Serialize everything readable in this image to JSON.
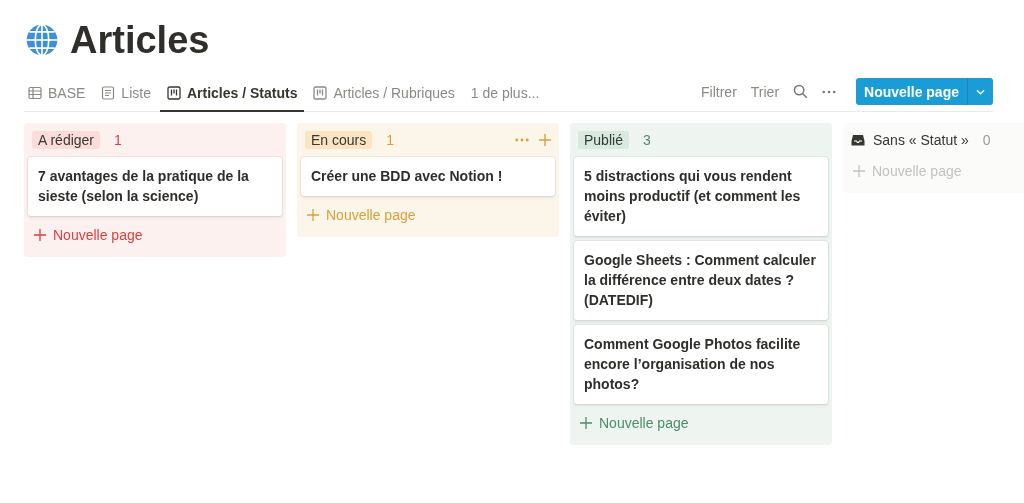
{
  "page": {
    "title": "Articles"
  },
  "tabs": [
    {
      "label": "BASE",
      "kind": "table",
      "selected": false
    },
    {
      "label": "Liste",
      "kind": "list",
      "selected": false
    },
    {
      "label": "Articles / Statuts",
      "kind": "board",
      "selected": true
    },
    {
      "label": "Articles / Rubriques",
      "kind": "board",
      "selected": false
    },
    {
      "label": "1 de plus...",
      "kind": "more",
      "selected": false
    }
  ],
  "toolbar": {
    "filter": "Filtrer",
    "sort": "Trier",
    "new_button": "Nouvelle page"
  },
  "columns": [
    {
      "kind": "status",
      "name": "A rédiger",
      "count": "1",
      "color": "#e03e3e",
      "hovered": false,
      "cards": [
        "7 avantages de la pratique de la sieste (selon la science)"
      ],
      "add_label": "Nouvelle page"
    },
    {
      "kind": "status",
      "name": "En cours",
      "count": "1",
      "color": "#d9a03a",
      "hovered": true,
      "cards": [
        "Créer une BDD avec Notion !"
      ],
      "add_label": "Nouvelle page"
    },
    {
      "kind": "status",
      "name": "Publié",
      "count": "3",
      "color": "#4d8b6a",
      "hovered": false,
      "cards": [
        "5 distractions qui vous rendent moins productif (et comment les éviter)",
        "Google Sheets : Comment calculer la différence entre deux dates ? (DATEDIF)",
        "Comment Google Photos facilite encore l’organisation de nos photos?"
      ],
      "add_label": "Nouvelle page"
    },
    {
      "kind": "none",
      "name": "Sans « Statut »",
      "count": "0",
      "color": "#9b9a97",
      "add_label": "Nouvelle page"
    }
  ]
}
